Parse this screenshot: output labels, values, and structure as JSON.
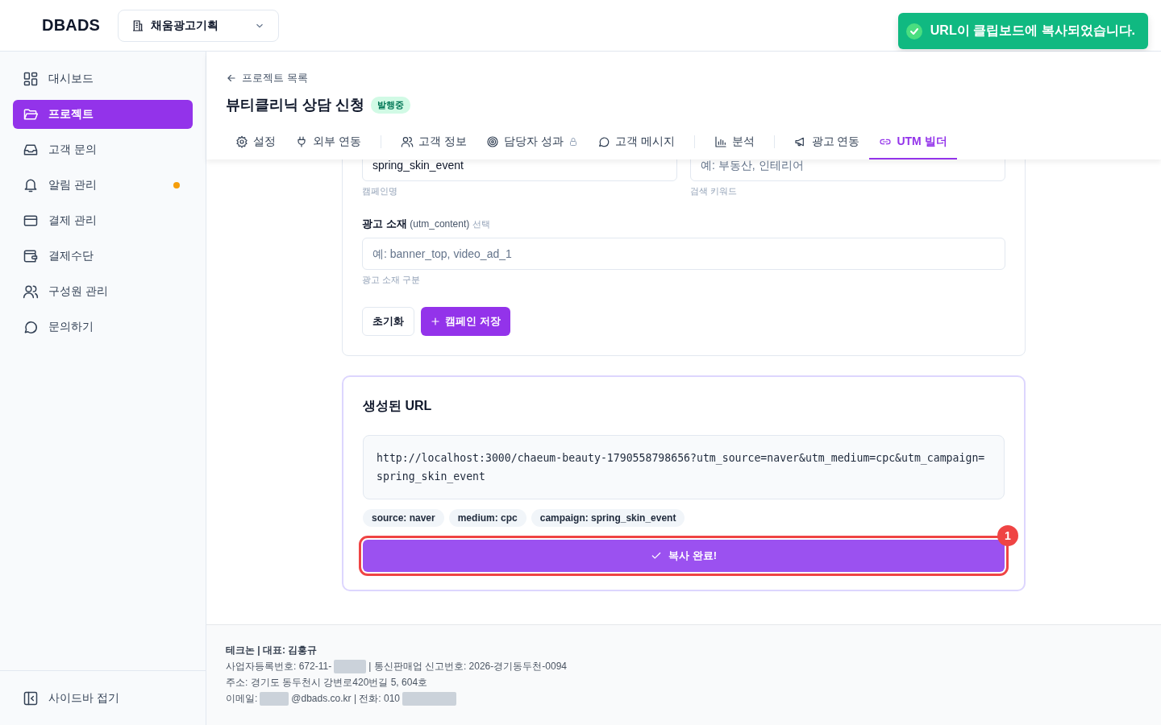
{
  "header": {
    "logo": "DBADS",
    "org_select": {
      "value": "채움광고기획"
    }
  },
  "toast": {
    "message": "URL이 클립보드에 복사되었습니다."
  },
  "sidebar": {
    "items": [
      {
        "label": "대시보드",
        "selected": false,
        "notification": false
      },
      {
        "label": "프로젝트",
        "selected": true,
        "notification": false
      },
      {
        "label": "고객 문의",
        "selected": false,
        "notification": false
      },
      {
        "label": "알림 관리",
        "selected": false,
        "notification": true
      },
      {
        "label": "결제 관리",
        "selected": false,
        "notification": false
      },
      {
        "label": "결제수단",
        "selected": false,
        "notification": false
      },
      {
        "label": "구성원 관리",
        "selected": false,
        "notification": false
      },
      {
        "label": "문의하기",
        "selected": false,
        "notification": false
      }
    ],
    "collapse": "사이드바 접기"
  },
  "page": {
    "back_link": "프로젝트 목록",
    "title": "뷰티클리닉 상담 신청",
    "status_badge": "발행중",
    "tabs": [
      {
        "label": "설정",
        "selected": false,
        "locked": false,
        "divider_after": false
      },
      {
        "label": "외부 연동",
        "selected": false,
        "locked": false,
        "divider_after": true
      },
      {
        "label": "고객 정보",
        "selected": false,
        "locked": false,
        "divider_after": false
      },
      {
        "label": "담당자 성과",
        "selected": false,
        "locked": true,
        "divider_after": false
      },
      {
        "label": "고객 메시지",
        "selected": false,
        "locked": false,
        "divider_after": true
      },
      {
        "label": "분석",
        "selected": false,
        "locked": false,
        "divider_after": true
      },
      {
        "label": "광고 연동",
        "selected": false,
        "locked": false,
        "divider_after": false
      },
      {
        "label": "UTM 빌더",
        "selected": true,
        "locked": false,
        "divider_after": false
      }
    ]
  },
  "form": {
    "fields": [
      {
        "value": "spring_skin_event",
        "helper": "캠페인명"
      },
      {
        "placeholder": "예: 부동산, 인테리어",
        "helper": "검색 키워드"
      }
    ],
    "content_field": {
      "label": "광고 소재",
      "param": "(utm_content)",
      "optional": "선택",
      "placeholder": "예: banner_top, video_ad_1",
      "helper": "광고 소재 구분"
    },
    "buttons": {
      "reset": "초기화",
      "save": "캠페인 저장"
    }
  },
  "result": {
    "title": "생성된 URL",
    "url": "http://localhost:3000/chaeum-beauty-1790558798656?utm_source=naver&utm_medium=cpc&utm_campaign=spring_skin_event",
    "chips": [
      "source: naver",
      "medium: cpc",
      "campaign: spring_skin_event"
    ],
    "copy_button": {
      "label": "복사 완료!",
      "highlighted": true,
      "marker": "1"
    }
  },
  "footer": {
    "lines": [
      {
        "segments": [
          {
            "kind": "text",
            "text": "테크논 | 대표: 김홍규"
          }
        ]
      },
      {
        "segments": [
          {
            "kind": "text",
            "text": "사업자등록번호: 672-11-"
          },
          {
            "kind": "redacted"
          },
          {
            "kind": "text",
            "text": "| 통신판매업 신고번호: 2026-경기동두천-0094"
          }
        ]
      },
      {
        "segments": [
          {
            "kind": "text",
            "text": "주소: 경기도 동두천시 강변로420번길 5, 604호"
          }
        ]
      },
      {
        "segments": [
          {
            "kind": "text",
            "text": "이메일:"
          },
          {
            "kind": "redacted"
          },
          {
            "kind": "text",
            "text": "@dbads.co.kr | 전화: 010"
          },
          {
            "kind": "redacted"
          }
        ]
      }
    ]
  }
}
